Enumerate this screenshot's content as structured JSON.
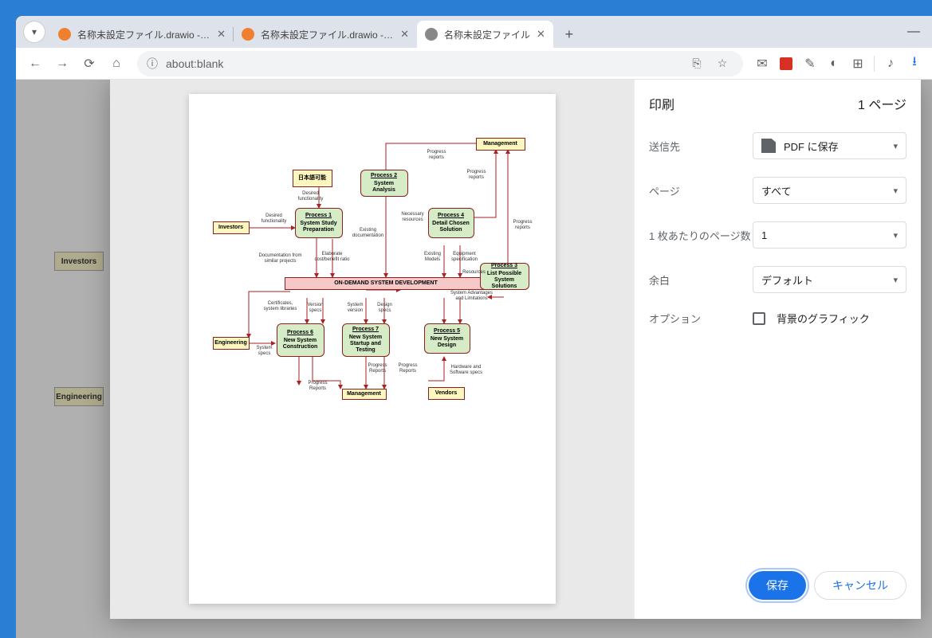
{
  "tabs": [
    {
      "title": "名称未設定ファイル.drawio - draw",
      "favicon": "draw",
      "active": false
    },
    {
      "title": "名称未設定ファイル.drawio - draw",
      "favicon": "draw",
      "active": false
    },
    {
      "title": "名称未設定ファイル",
      "favicon": "blank",
      "active": true
    }
  ],
  "address": "about:blank",
  "peek": {
    "investors": "Investors",
    "engineering": "Engineering"
  },
  "print": {
    "title": "印刷",
    "pages_info": "1 ページ",
    "rows": {
      "dest_label": "送信先",
      "dest_value": "PDF に保存",
      "pages_label": "ページ",
      "pages_value": "すべて",
      "sheets_label": "1 枚あたりのページ数",
      "sheets_value": "1",
      "margin_label": "余白",
      "margin_value": "デフォルト",
      "options_label": "オプション",
      "bg_graphics": "背景のグラフィック"
    },
    "save": "保存",
    "cancel": "キャンセル"
  },
  "diagram": {
    "jp": "日本語可能",
    "investors": "Investors",
    "engineering": "Engineering",
    "management": "Management",
    "management2": "Management",
    "vendors": "Vendors",
    "center": "ON-DEMAND SYSTEM DEVELOPMENT",
    "p1_hdr": "Process 1",
    "p1": "System Study Preparation",
    "p2_hdr": "Process 2",
    "p2": "System Analysis",
    "p3_hdr": "Process 3",
    "p3": "List Possible System Solutions",
    "p4_hdr": "Process 4",
    "p4": "Detail Chosen Solution",
    "p5_hdr": "Process 5",
    "p5": "New System Design",
    "p6_hdr": "Process 6",
    "p6": "New System Construction",
    "p7_hdr": "Process 7",
    "p7": "New System Startup and Testing",
    "labels": {
      "desired_func": "Desired functionality",
      "desired_func2": "Desired functionality",
      "doc_similar": "Documentation from similar projects",
      "elaborate": "Elaborate cost/benefit ratio",
      "existing_doc": "Existing documentation",
      "progress1": "Progress reports",
      "progress2": "Progress reports",
      "progress3": "Progress reports",
      "progress4": "Progress Reports",
      "progress5": "Progress Reports",
      "progress6": "Progress Reports",
      "necessary": "Necessary resources",
      "existing_models": "Existing Models",
      "equip_spec": "Equipment specification",
      "resources": "Resources",
      "sys_adv": "System Advantages and Limitations",
      "cert": "Certificates, system libraries",
      "version": "Version specs",
      "sys_version": "System version",
      "design_specs": "Design specs",
      "sys_specs": "System specs",
      "hw_sw": "Hardware and Software specs"
    }
  }
}
